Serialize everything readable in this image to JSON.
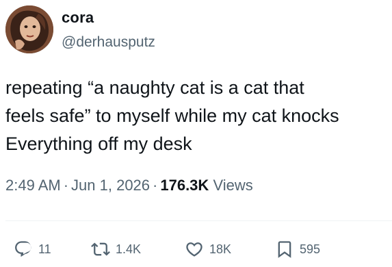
{
  "author": {
    "display_name": "cora",
    "handle": "@derhausputz",
    "avatar_icon": "profile-photo"
  },
  "tweet": {
    "text_lines": [
      "repeating “a naughty cat is a cat that",
      "feels safe” to myself while my cat knocks",
      "Everything off my desk"
    ],
    "time": "2:49 AM",
    "date": "Jun 1, 2026",
    "separator": "·",
    "views_count": "176.3K",
    "views_label": "Views"
  },
  "actions": {
    "reply": {
      "icon": "reply-bubble-icon",
      "count": "11"
    },
    "retweet": {
      "icon": "retweet-icon",
      "count": "1.4K"
    },
    "like": {
      "icon": "heart-icon",
      "count": "18K"
    },
    "bookmark": {
      "icon": "bookmark-icon",
      "count": "595"
    }
  },
  "colors": {
    "text_primary": "#0f1419",
    "text_secondary": "#536471",
    "divider": "#eff3f4"
  }
}
